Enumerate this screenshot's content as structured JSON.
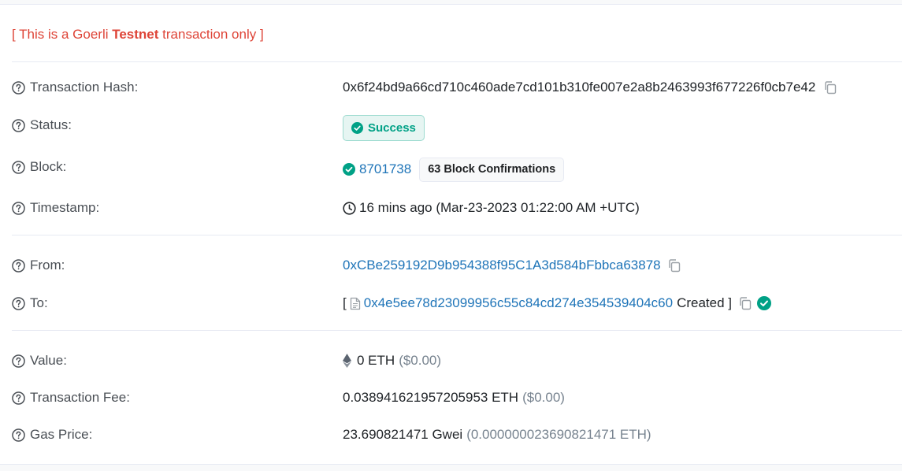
{
  "notice": {
    "prefix": "[ This is a Goerli ",
    "bold": "Testnet",
    "suffix": " transaction only ]"
  },
  "fields": {
    "tx_hash": {
      "label": "Transaction Hash:",
      "value": "0x6f24bd9a66cd710c460ade7cd101b310fe007e2a8b2463993f677226f0cb7e42"
    },
    "status": {
      "label": "Status:",
      "value": "Success"
    },
    "block": {
      "label": "Block:",
      "number": "8701738",
      "confirmations": "63 Block Confirmations"
    },
    "timestamp": {
      "label": "Timestamp:",
      "value": "16 mins ago (Mar-23-2023 01:22:00 AM +UTC)"
    },
    "from": {
      "label": "From:",
      "value": "0xCBe259192D9b954388f95C1A3d584bFbbca63878"
    },
    "to": {
      "label": "To:",
      "open": "[",
      "address": "0x4e5ee78d23099956c55c84cd274e354539404c60",
      "created": "Created ]"
    },
    "value": {
      "label": "Value:",
      "amount": "0 ETH",
      "usd": "($0.00)"
    },
    "fee": {
      "label": "Transaction Fee:",
      "amount": "0.038941621957205953 ETH",
      "usd": "($0.00)"
    },
    "gas_price": {
      "label": "Gas Price:",
      "amount": "23.690821471 Gwei",
      "eth": "(0.000000023690821471 ETH)"
    }
  },
  "colors": {
    "notice_red": "#de4437",
    "link_blue": "#1e74b8",
    "success_green": "#00a186"
  },
  "icons": {
    "question": "question-circle-icon",
    "copy": "copy-icon",
    "check": "check-circle-icon",
    "clock": "clock-icon",
    "contract": "file-icon",
    "eth": "ethereum-icon"
  }
}
